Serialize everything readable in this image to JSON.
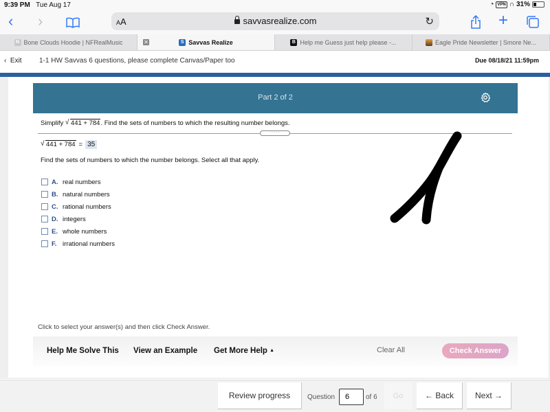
{
  "status_bar": {
    "time": "9:39 PM",
    "date": "Tue Aug 17",
    "vpn_label": "VPN",
    "battery_text": "31%",
    "battery_level": 0.31
  },
  "toolbar": {
    "text_size_label": "AA",
    "url": "savvasrealize.com",
    "icons": [
      "back-icon",
      "forward-icon",
      "bookmarks-icon",
      "lock-icon",
      "reload-icon",
      "share-icon",
      "new-tab-icon",
      "tabs-icon"
    ]
  },
  "tabs": [
    {
      "label": "Bone Clouds Hoodie | NFRealMusic",
      "favicon": "N",
      "active": false
    },
    {
      "label": "Savvas Realize",
      "favicon": "S",
      "active": true
    },
    {
      "label": "Help me Guess just help please -...",
      "favicon": "B",
      "active": false
    },
    {
      "label": "Eagle Pride Newsletter | Smore Ne...",
      "favicon": "",
      "active": false
    }
  ],
  "assignment": {
    "exit_label": "Exit",
    "title": "1-1 HW Savvas 6 questions, please complete Canvas/Paper too",
    "due": "Due 08/18/21 11:59pm"
  },
  "question": {
    "part_label": "Part 2 of 2",
    "prompt_prefix": "Simplify",
    "radicand": "441 + 784",
    "prompt_suffix": ". Find the sets of numbers to which the resulting number belongs.",
    "equals": "=",
    "answer": "35",
    "instruction": "Find the sets of numbers to which the number belongs. Select all that apply.",
    "options": [
      {
        "letter": "A.",
        "text": "real numbers",
        "checked": false
      },
      {
        "letter": "B.",
        "text": "natural numbers",
        "checked": false
      },
      {
        "letter": "C.",
        "text": "rational numbers",
        "checked": false
      },
      {
        "letter": "D.",
        "text": "integers",
        "checked": false
      },
      {
        "letter": "E.",
        "text": "whole numbers",
        "checked": false
      },
      {
        "letter": "F.",
        "text": "irrational numbers",
        "checked": false
      }
    ],
    "hint": "Click to select your answer(s) and then click Check Answer."
  },
  "help_bar": {
    "help_me_solve": "Help Me Solve This",
    "view_example": "View an Example",
    "get_more_help": "Get More Help",
    "clear_all": "Clear All",
    "check_answer": "Check Answer"
  },
  "bottom_nav": {
    "review_progress": "Review progress",
    "question_label": "Question",
    "question_value": "6",
    "of_label": "of 6",
    "go_label": "Go",
    "back_label": "Back",
    "next_label": "Next"
  },
  "colors": {
    "part_header": "#347392",
    "brand_stripe": "#2b5fa0",
    "check_answer": "#e2a6c2",
    "link_blue": "#3478f6"
  }
}
